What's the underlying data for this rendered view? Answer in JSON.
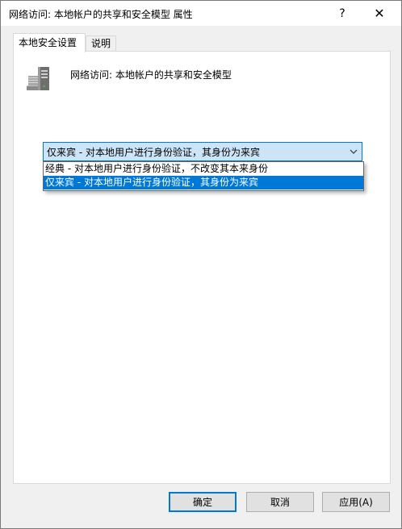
{
  "window": {
    "title": "网络访问: 本地帐户的共享和安全模型 属性",
    "help_label": "?",
    "close_label": "✕"
  },
  "tabs": [
    {
      "label": "本地安全设置",
      "active": true
    },
    {
      "label": "说明",
      "active": false
    }
  ],
  "panel": {
    "icon": "server-icon",
    "policy_title": "网络访问: 本地帐户的共享和安全模型"
  },
  "combo": {
    "selected": "仅来宾 - 对本地用户进行身份验证，其身份为来宾",
    "options": [
      "经典 - 对本地用户进行身份验证，不改变其本来身份",
      "仅来宾 - 对本地用户进行身份验证，其身份为来宾"
    ],
    "highlighted_index": 1
  },
  "buttons": {
    "ok": "确定",
    "cancel": "取消",
    "apply": "应用(A)"
  },
  "colors": {
    "accent": "#0078d7",
    "combo_bg": "#cce4f7",
    "dialog_bg": "#f0f0f0"
  }
}
